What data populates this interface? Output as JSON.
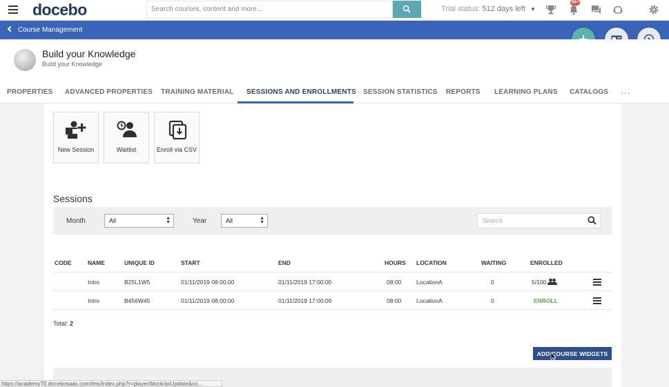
{
  "topbar": {
    "logo": "docebo",
    "search_placeholder": "Search courses, content and more...",
    "trial_label": "Trial status:",
    "trial_days": "512 days left",
    "notifications_badge": "99+",
    "icons": [
      "menu-icon",
      "search-icon",
      "trophy-icon",
      "bell-icon",
      "chat-icon",
      "helpdesk-icon",
      "gear-icon"
    ]
  },
  "bluebar": {
    "back_label": "Course Management"
  },
  "course": {
    "title": "Build your Knowledge",
    "subtitle": "Build your Knowledge"
  },
  "tabs": [
    {
      "label": "PROPERTIES"
    },
    {
      "label": "ADVANCED PROPERTIES"
    },
    {
      "label": "TRAINING MATERIAL"
    },
    {
      "label": "SESSIONS AND ENROLLMENTS",
      "active": true
    },
    {
      "label": "SESSION STATISTICS"
    },
    {
      "label": "REPORTS"
    },
    {
      "label": "LEARNING PLANS"
    },
    {
      "label": "CATALOGS"
    }
  ],
  "tabs_more": "...",
  "actions": [
    {
      "label": "New Session",
      "icon": "new-session-icon"
    },
    {
      "label": "Waitlist",
      "icon": "waitlist-icon"
    },
    {
      "label": "Enroll via CSV",
      "icon": "enroll-csv-icon"
    }
  ],
  "sessions": {
    "heading": "Sessions",
    "filters": {
      "month_label": "Month",
      "month_value": "All",
      "year_label": "Year",
      "year_value": "All",
      "search_placeholder": "Search"
    },
    "columns": [
      "CODE",
      "NAME",
      "UNIQUE ID",
      "START",
      "END",
      "HOURS",
      "LOCATION",
      "WAITING",
      "ENROLLED"
    ],
    "rows": [
      {
        "code": "",
        "name": "Intro",
        "unique_id": "B25L1W5",
        "start": "01/11/2019 08:00:00",
        "end": "01/11/2019 17:00:00",
        "hours": "08:00",
        "location": "LocationA",
        "waiting": "0",
        "enrolled": "5/100"
      },
      {
        "code": "",
        "name": "Intro",
        "unique_id": "B456W45",
        "start": "01/11/2019 08:00:00",
        "end": "01/11/2019 17:00:00",
        "hours": "08:00",
        "location": "LocationA",
        "waiting": "0",
        "enrolled": "ENROLL"
      }
    ],
    "total_label": "Total:",
    "total_value": "2"
  },
  "widgets_button": "ADD COURSE WIDGETS",
  "status_url": "https://academy70.docebosaas.com/lms/index.php?r=player/block/axUpdate&co..."
}
